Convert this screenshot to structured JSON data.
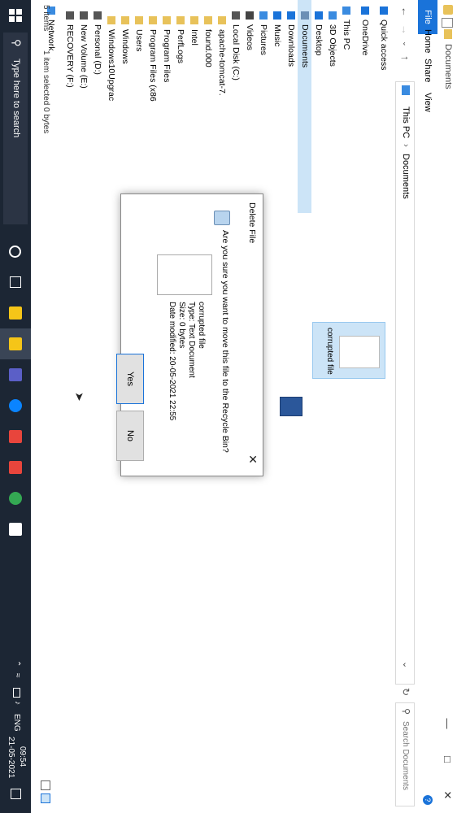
{
  "window": {
    "title": "Documents",
    "breadcrumb": [
      "This PC",
      "Documents"
    ],
    "search_placeholder": "Search Documents"
  },
  "ribbon": {
    "tabs": [
      "File",
      "Home",
      "Share",
      "View"
    ]
  },
  "nav": {
    "items": [
      {
        "label": "Quick access",
        "icon": "star-icon",
        "color": "#1a73d9"
      },
      {
        "label": "OneDrive",
        "icon": "cloud-icon",
        "color": "#1a73d9"
      },
      {
        "label": "This PC",
        "icon": "pc-icon",
        "color": "#3a8be0"
      },
      {
        "label": "3D Objects",
        "icon": "cube-icon",
        "color": "#3a8be0"
      },
      {
        "label": "Desktop",
        "icon": "desktop-icon",
        "color": "#1a73d9"
      },
      {
        "label": "Documents",
        "icon": "documents-icon",
        "color": "#6b8fb5",
        "selected": true
      },
      {
        "label": "Downloads",
        "icon": "download-icon",
        "color": "#1a73d9"
      },
      {
        "label": "Music",
        "icon": "music-icon",
        "color": "#1a73d9"
      },
      {
        "label": "Pictures",
        "icon": "pictures-icon",
        "color": "#3a8be0"
      },
      {
        "label": "Videos",
        "icon": "videos-icon",
        "color": "#444"
      },
      {
        "label": "Local Disk (C:)",
        "icon": "drive-icon",
        "color": "#555"
      },
      {
        "label": "apache-tomcat-7.",
        "icon": "folder-icon",
        "color": "#e8c25a"
      },
      {
        "label": "found.000",
        "icon": "folder-icon",
        "color": "#e8c25a"
      },
      {
        "label": "Intel",
        "icon": "folder-icon",
        "color": "#e8c25a"
      },
      {
        "label": "PerfLogs",
        "icon": "folder-icon",
        "color": "#e8c25a"
      },
      {
        "label": "Program Files",
        "icon": "folder-icon",
        "color": "#e8c25a"
      },
      {
        "label": "Program Files (x86",
        "icon": "folder-icon",
        "color": "#e8c25a"
      },
      {
        "label": "Users",
        "icon": "folder-icon",
        "color": "#e8c25a"
      },
      {
        "label": "Windows",
        "icon": "folder-icon",
        "color": "#e8c25a"
      },
      {
        "label": "Windows10Upgrac",
        "icon": "folder-icon",
        "color": "#e8c25a"
      },
      {
        "label": "Personal (D:)",
        "icon": "drive-icon",
        "color": "#555"
      },
      {
        "label": "New Volume (E:)",
        "icon": "drive-icon",
        "color": "#555"
      },
      {
        "label": "RECOVERY (F:)",
        "icon": "drive-icon",
        "color": "#555"
      },
      {
        "label": "Network",
        "icon": "network-icon",
        "color": "#3a8be0"
      }
    ]
  },
  "content": {
    "file_label": "corrupted file"
  },
  "status": {
    "items_count": "5 items",
    "selection": "1 item selected  0 bytes"
  },
  "dialog": {
    "title": "Delete File",
    "question": "Are you sure you want to move this file to the Recycle Bin?",
    "file_name": "corrupted file",
    "file_type": "Type: Text Document",
    "file_size": "Size: 0 bytes",
    "file_date": "Date modified: 20-05-2021 22:55",
    "yes_label": "Yes",
    "no_label": "No"
  },
  "taskbar": {
    "search_placeholder": "Type here to search",
    "language": "ENG",
    "time": "09:54",
    "date": "21-05-2021",
    "app_colors": [
      "#f5c518",
      "#f5c518",
      "#5b5fc7",
      "#0a84ff",
      "#e8453c",
      "#e8453c",
      "#34a853",
      "#ffffff"
    ]
  }
}
